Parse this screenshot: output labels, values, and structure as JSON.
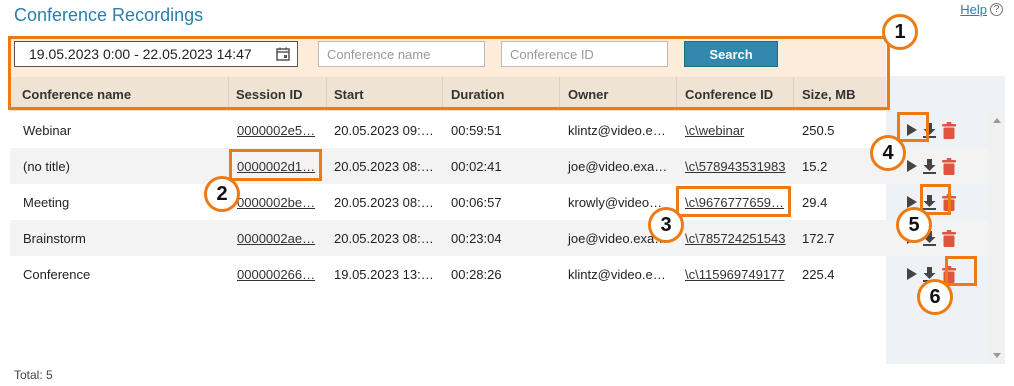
{
  "page": {
    "title": "Conference Recordings",
    "help_label": "Help",
    "help_icon": "?",
    "total": "Total: 5"
  },
  "filter": {
    "date_range": "19.05.2023 0:00 - 22.05.2023 14:47",
    "conference_name_placeholder": "Conference name",
    "conference_id_placeholder": "Conference ID",
    "search_label": "Search"
  },
  "columns": [
    "Conference name",
    "Session ID",
    "Start",
    "Duration",
    "Owner",
    "Conference ID",
    "Size, MB"
  ],
  "rows": [
    {
      "name": "Webinar",
      "session": "0000002e5…",
      "start": "20.05.2023 09:…",
      "duration": "00:59:51",
      "owner": "klintz@video.e…",
      "conf_id": "\\c\\webinar",
      "size": "250.5"
    },
    {
      "name": "(no title)",
      "session": "0000002d1…",
      "start": "20.05.2023 08:…",
      "duration": "00:02:41",
      "owner": "joe@video.exa…",
      "conf_id": "\\c\\578943531983",
      "size": "15.2"
    },
    {
      "name": "Meeting",
      "session": "0000002be…",
      "start": "20.05.2023 08:…",
      "duration": "00:06:57",
      "owner": "krowly@video…",
      "conf_id": "\\c\\9676777659…",
      "size": "29.4"
    },
    {
      "name": "Brainstorm",
      "session": "0000002ae…",
      "start": "20.05.2023 08:…",
      "duration": "00:23:04",
      "owner": "joe@video.exa…",
      "conf_id": "\\c\\785724251543",
      "size": "172.7"
    },
    {
      "name": "Conference",
      "session": "000000266…",
      "start": "19.05.2023 13:…",
      "duration": "00:28:26",
      "owner": "klintz@video.e…",
      "conf_id": "\\c\\115969749177",
      "size": "225.4"
    }
  ],
  "badges": [
    "1",
    "2",
    "3",
    "4",
    "5",
    "6"
  ],
  "colors": {
    "accent": "#2a7fad",
    "highlight": "#ee7a14",
    "delete": "#e0533f",
    "filter_bg": "#fcecd9",
    "search_button": "#3187ad"
  },
  "icons": {
    "calendar": "calendar-icon",
    "play": "play-icon",
    "download": "download-icon",
    "delete": "trash-icon"
  }
}
